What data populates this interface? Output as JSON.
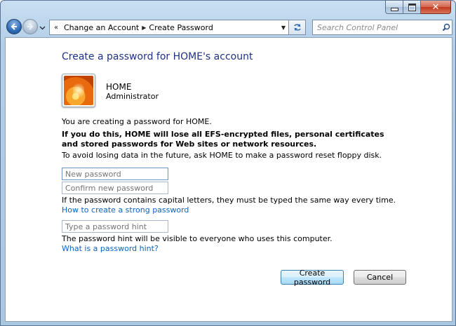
{
  "window": {
    "caption_buttons": {
      "minimize": "minimize-icon",
      "maximize": "maximize-icon",
      "close": "close-icon"
    }
  },
  "nav": {
    "breadcrumbs": [
      "Change an Account",
      "Create Password"
    ],
    "search_placeholder": "Search Control Panel"
  },
  "content": {
    "heading": "Create a password for HOME's account",
    "user": {
      "name": "HOME",
      "role": "Administrator"
    },
    "intro": "You are creating a password for HOME.",
    "warning": "If you do this, HOME will lose all EFS-encrypted files, personal certificates and stored passwords for Web sites or network resources.",
    "advice": "To avoid losing data in the future, ask HOME to make a password reset floppy disk.",
    "fields": {
      "new_password_placeholder": "New password",
      "confirm_password_placeholder": "Confirm new password",
      "hint_placeholder": "Type a password hint"
    },
    "caps_note": "If the password contains capital letters, they must be typed the same way every time.",
    "strong_password_link": "How to create a strong password",
    "hint_note": "The password hint will be visible to everyone who uses this computer.",
    "hint_link": "What is a password hint?",
    "buttons": {
      "create": "Create password",
      "cancel": "Cancel"
    }
  }
}
